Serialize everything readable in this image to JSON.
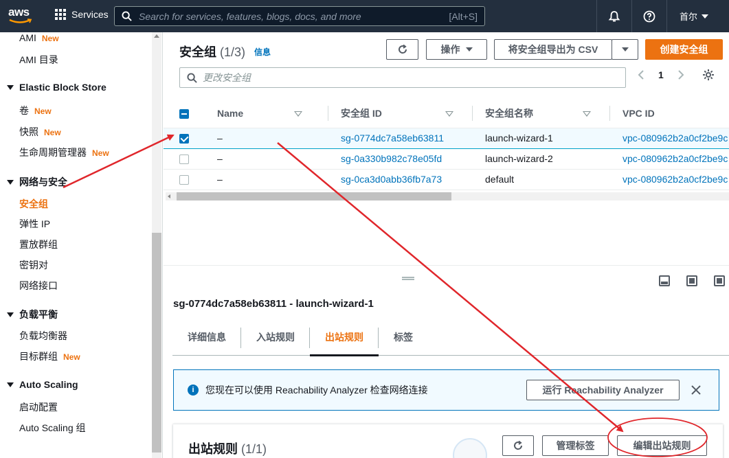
{
  "topnav": {
    "logo_text": "aws",
    "services_label": "Services",
    "search_placeholder": "Search for services, features, blogs, docs, and more",
    "search_shortcut": "[Alt+S]",
    "region_label": "首尔"
  },
  "sidebar": {
    "items": [
      {
        "label": "AMI",
        "badge": "New"
      },
      {
        "label": "AMI 目录"
      },
      {
        "section": "Elastic Block Store"
      },
      {
        "label": "卷",
        "badge": "New"
      },
      {
        "label": "快照",
        "badge": "New"
      },
      {
        "label": "生命周期管理器",
        "badge": "New"
      },
      {
        "section": "网络与安全"
      },
      {
        "label": "安全组",
        "active": true
      },
      {
        "label": "弹性 IP"
      },
      {
        "label": "置放群组"
      },
      {
        "label": "密钥对"
      },
      {
        "label": "网络接口"
      },
      {
        "section": "负载平衡"
      },
      {
        "label": "负载均衡器"
      },
      {
        "label": "目标群组",
        "badge": "New"
      },
      {
        "section": "Auto Scaling"
      },
      {
        "label": "启动配置"
      },
      {
        "label": "Auto Scaling 组"
      }
    ]
  },
  "list": {
    "title": "安全组",
    "count": "(1/3)",
    "info_link": "信息",
    "actions_label": "操作",
    "export_label": "将安全组导出为 CSV",
    "create_label": "创建安全组",
    "filter_placeholder": "更改安全组",
    "page_number": "1",
    "columns": [
      "Name",
      "安全组 ID",
      "安全组名称",
      "VPC ID"
    ],
    "rows": [
      {
        "name": "–",
        "id": "sg-0774dc7a58eb63811",
        "group_name": "launch-wizard-1",
        "vpc": "vpc-080962b2a0cf2be9c",
        "selected": true
      },
      {
        "name": "–",
        "id": "sg-0a330b982c78e05fd",
        "group_name": "launch-wizard-2",
        "vpc": "vpc-080962b2a0cf2be9c",
        "selected": false
      },
      {
        "name": "–",
        "id": "sg-0ca3d0abb36fb7a73",
        "group_name": "default",
        "vpc": "vpc-080962b2a0cf2be9c",
        "selected": false
      }
    ]
  },
  "detail": {
    "title": "sg-0774dc7a58eb63811 - launch-wizard-1",
    "tabs": [
      "详细信息",
      "入站规则",
      "出站规则",
      "标签"
    ],
    "active_tab": 2,
    "alert_text": "您现在可以使用 Reachability Analyzer 检查网络连接",
    "alert_button": "运行 Reachability Analyzer",
    "rules_title": "出站规则",
    "rules_count": "(1/1)",
    "manage_tags_label": "管理标签",
    "edit_outbound_label": "编辑出站规则"
  },
  "colors": {
    "nav_bg": "#232f3e",
    "accent_orange": "#ec7211",
    "link_blue": "#0073bb",
    "annotation_red": "#e0262b"
  }
}
